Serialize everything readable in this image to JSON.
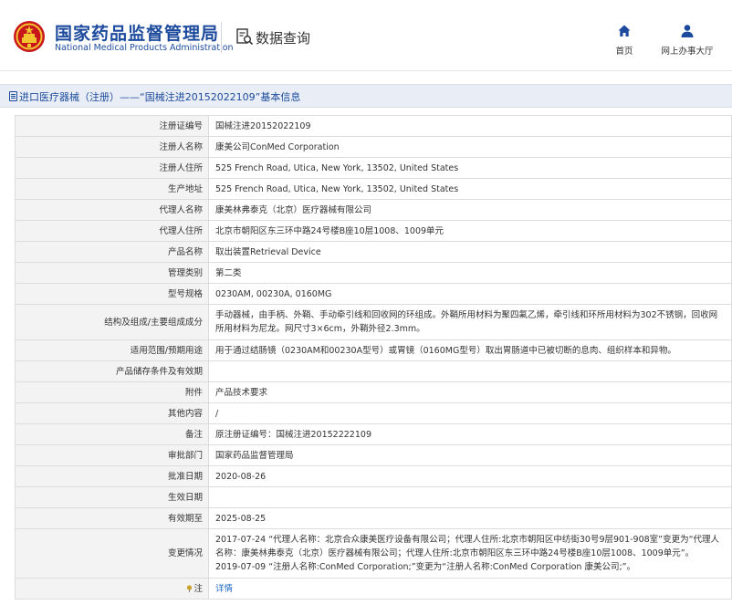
{
  "header": {
    "brand_cn": "国家药品监督管理局",
    "brand_en": "National Medical Products Administration",
    "section_label": "数据查询",
    "nav": [
      {
        "label": "首页",
        "icon": "home-icon"
      },
      {
        "label": "网上办事大厅",
        "icon": "user-icon"
      }
    ]
  },
  "title_bar": {
    "text": "进口医疗器械（注册）——“国械注进20152022109”基本信息"
  },
  "fields": [
    {
      "key": "注册证编号",
      "value": "国械注进20152022109"
    },
    {
      "key": "注册人名称",
      "value": "康美公司ConMed Corporation"
    },
    {
      "key": "注册人住所",
      "value": "525 French Road, Utica, New York, 13502, United States"
    },
    {
      "key": "生产地址",
      "value": "525 French Road, Utica, New York, 13502, United States"
    },
    {
      "key": "代理人名称",
      "value": "康美林弗泰克（北京）医疗器械有限公司"
    },
    {
      "key": "代理人住所",
      "value": "北京市朝阳区东三环中路24号楼B座10层1008、1009单元"
    },
    {
      "key": "产品名称",
      "value": "取出装置Retrieval Device"
    },
    {
      "key": "管理类别",
      "value": "第二类"
    },
    {
      "key": "型号规格",
      "value": "0230AM, 00230A, 0160MG"
    },
    {
      "key": "结构及组成/主要组成成分",
      "value": "手动器械，由手柄、外鞘、手动牵引线和回收网的环组成。外鞘所用材料为聚四氟乙烯，牵引线和环所用材料为302不锈钢，回收网所用材料为尼龙。网尺寸3×6cm，外鞘外径2.3mm。"
    },
    {
      "key": "适用范围/预期用途",
      "value": "用于通过结肠镜（0230AM和00230A型号）或胃镜（0160MG型号）取出胃肠道中已被切断的息肉、组织样本和异物。"
    },
    {
      "key": "产品储存条件及有效期",
      "value": ""
    },
    {
      "key": "附件",
      "value": "产品技术要求"
    },
    {
      "key": "其他内容",
      "value": "/"
    },
    {
      "key": "备注",
      "value": "原注册证编号：国械注进20152222109"
    },
    {
      "key": "审批部门",
      "value": "国家药品监督管理局"
    },
    {
      "key": "批准日期",
      "value": "2020-08-26"
    },
    {
      "key": "生效日期",
      "value": ""
    },
    {
      "key": "有效期至",
      "value": "2025-08-25"
    },
    {
      "key": "变更情况",
      "value": "2017-07-24 “代理人名称：北京合众康美医疗设备有限公司；代理人住所:北京市朝阳区中纺街30号9层901-908室”变更为“代理人名称：康美林弗泰克（北京）医疗器械有限公司；代理人住所:北京市朝阳区东三环中路24号楼B座10层1008、1009单元”。\n2019-07-09 “注册人名称:ConMed Corporation;”变更为“注册人名称:ConMed Corporation 康美公司;”。"
    }
  ],
  "note": {
    "key": "注",
    "link_label": "详情"
  },
  "colors": {
    "brand": "#1c4a9c",
    "title_bar_bg": "#e9eef6",
    "key_bg": "#f3f3f3",
    "link": "#1c68c9"
  }
}
